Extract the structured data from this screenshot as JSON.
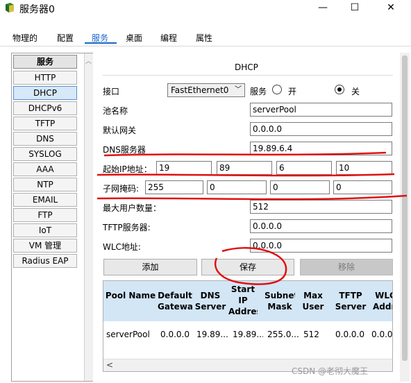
{
  "window": {
    "title": "服务器0",
    "minimize_glyph": "—",
    "maximize_glyph": "☐",
    "close_glyph": "✕"
  },
  "tabs": [
    "物理的",
    "配置",
    "服务",
    "桌面",
    "编程",
    "属性"
  ],
  "services": {
    "header": "服务",
    "items": [
      "HTTP",
      "DHCP",
      "DHCPv6",
      "TFTP",
      "DNS",
      "SYSLOG",
      "AAA",
      "NTP",
      "EMAIL",
      "FTP",
      "IoT",
      "VM 管理",
      "Radius EAP"
    ],
    "active": "DHCP"
  },
  "dhcp": {
    "section_title": "DHCP",
    "interface_label": "接口",
    "interface_value": "FastEthernet0",
    "service_label": "服务",
    "on_label": "开",
    "off_label": "关",
    "service_state": "off",
    "pool_name_label": "池名称",
    "pool_name_value": "serverPool",
    "gateway_label": "默认网关",
    "gateway_value": "0.0.0.0",
    "dns_label": "DNS服务器",
    "dns_value": "19.89.6.4",
    "start_ip_label": "起始IP地址：",
    "start_ip": [
      "19",
      "89",
      "6",
      "10"
    ],
    "mask_label": "子网掩码:",
    "mask": [
      "255",
      "0",
      "0",
      "0"
    ],
    "max_users_label": "最大用户数量：",
    "max_users_value": "512",
    "tftp_label": "TFTP服务器:",
    "tftp_value": "0.0.0.0",
    "wlc_label": "WLC地址:",
    "wlc_value": "0.0.0.0",
    "add_button": "添加",
    "save_button": "保存",
    "remove_button": "移除"
  },
  "table": {
    "headers": [
      "Pool Name",
      "Default Gatewa",
      "DNS Server",
      "Start IP Address",
      "Subnet Mask",
      "Max User",
      "TFTP Server",
      "WLC Address"
    ],
    "rows": [
      [
        "serverPool",
        "0.0.0.0",
        "19.89...",
        "19.89...",
        "255.0...",
        "512",
        "0.0.0.0",
        "0.0.0.0"
      ]
    ],
    "scroll_left_glyph": "<"
  },
  "watermark": "CSDN @老彻大魔王",
  "colors": {
    "annotation_red": "#e01010",
    "table_header_bg": "#d3e6f6",
    "active_tab_underline": "#1a66c8"
  }
}
